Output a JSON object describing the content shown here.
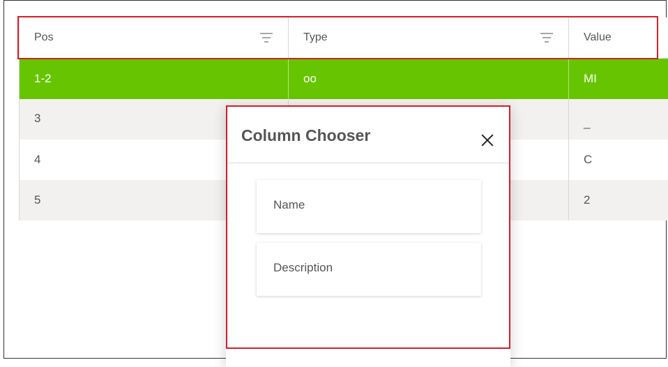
{
  "grid": {
    "columns": [
      {
        "label": "Pos",
        "filter_icon": "filter-icon"
      },
      {
        "label": "Type",
        "filter_icon": "filter-icon"
      },
      {
        "label": "Value"
      }
    ],
    "rows": [
      {
        "pos": "1-2",
        "type": "oo",
        "value": "MI",
        "selected": true
      },
      {
        "pos": "3",
        "type": "",
        "value": "_"
      },
      {
        "pos": "4",
        "type": "",
        "value": "C"
      },
      {
        "pos": "5",
        "type": "",
        "value": "2"
      }
    ],
    "colors": {
      "selected_row": "#66c500",
      "alt_row": "#f2f1ef",
      "highlight_border": "#d21f2a"
    }
  },
  "column_chooser": {
    "title": "Column Chooser",
    "close_icon": "close-icon",
    "items": [
      "Name",
      "Description"
    ]
  }
}
